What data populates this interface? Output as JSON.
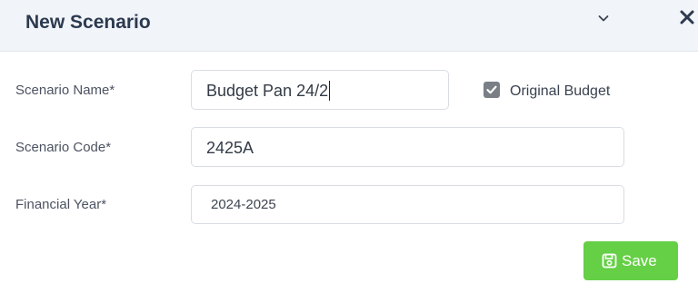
{
  "modal": {
    "title": "New Scenario",
    "close_icon": "close-icon"
  },
  "form": {
    "scenario_name": {
      "label": "Scenario Name*",
      "value": "Budget Pan 24/2"
    },
    "original_budget": {
      "label": "Original Budget",
      "checked": true
    },
    "scenario_code": {
      "label": "Scenario Code*",
      "value": "2425A"
    },
    "financial_year": {
      "label": "Financial Year*",
      "selected": "2024-2025"
    }
  },
  "actions": {
    "save_label": "Save",
    "save_icon": "floppy-disk-icon",
    "save_color": "#65cf45"
  }
}
